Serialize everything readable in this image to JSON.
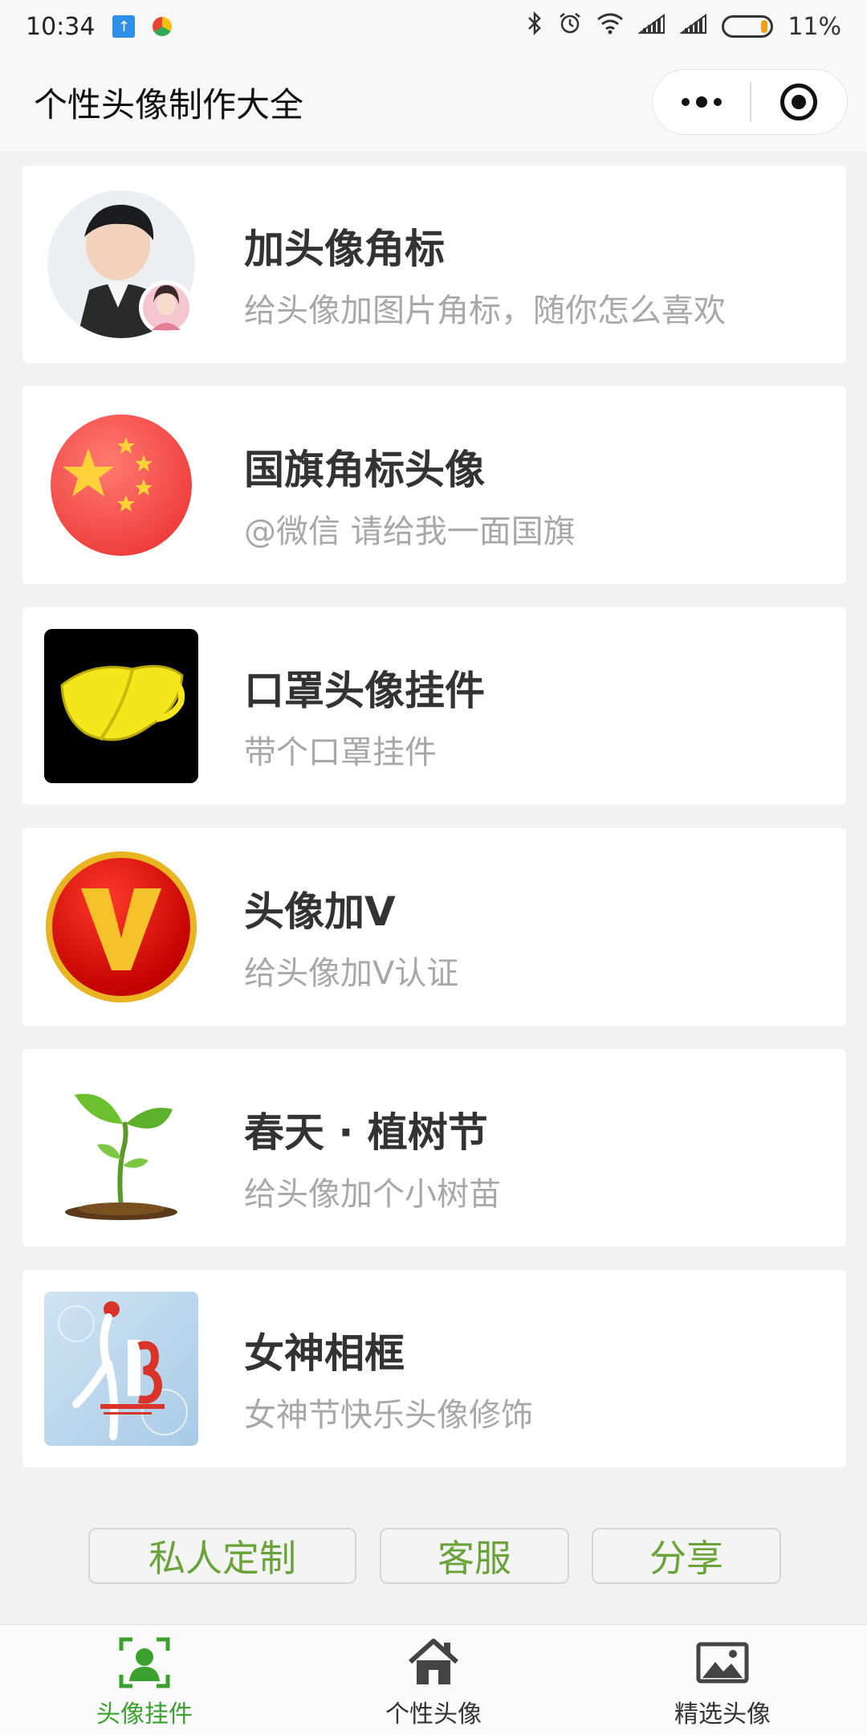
{
  "status_bar": {
    "time": "10:34",
    "battery": "11%",
    "icons": [
      "upload-notification-icon",
      "app-notification-icon",
      "bluetooth-icon",
      "alarm-icon",
      "wifi-icon",
      "signal-icon",
      "signal-icon",
      "battery-icon"
    ]
  },
  "header": {
    "title": "个性头像制作大全"
  },
  "cards": [
    {
      "title": "加头像角标",
      "subtitle": "给头像加图片角标，随你怎么喜欢",
      "icon": "avatar-badge-icon"
    },
    {
      "title": "国旗角标头像",
      "subtitle": "@微信 请给我一面国旗",
      "icon": "china-flag-icon"
    },
    {
      "title": "口罩头像挂件",
      "subtitle": "带个口罩挂件",
      "icon": "mask-icon"
    },
    {
      "title": "头像加V",
      "subtitle": "给头像加V认证",
      "icon": "v-badge-icon"
    },
    {
      "title": "春天 · 植树节",
      "subtitle": "给头像加个小树苗",
      "icon": "sprout-icon"
    },
    {
      "title": "女神相框",
      "subtitle": "女神节快乐头像修饰",
      "icon": "goddess-frame-icon"
    }
  ],
  "actions": {
    "custom": "私人定制",
    "service": "客服",
    "share": "分享"
  },
  "tabs": [
    {
      "label": "头像挂件",
      "icon": "avatar-frame-icon",
      "active": true
    },
    {
      "label": "个性头像",
      "icon": "home-icon",
      "active": false
    },
    {
      "label": "精选头像",
      "icon": "picture-icon",
      "active": false
    }
  ],
  "colors": {
    "accent": "#3aa02e",
    "button_text": "#6aa33a",
    "background": "#f2f2f2"
  }
}
